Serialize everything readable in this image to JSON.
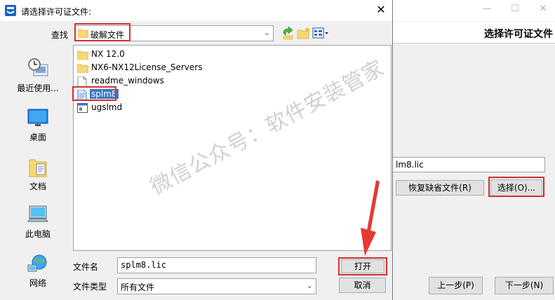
{
  "dialog": {
    "title": "请选择许可证文件:",
    "close_glyph": "✕",
    "look_in_label": "查找",
    "look_in_value": "破解文件",
    "sidebar": [
      {
        "label": "最近使用...",
        "icon": "recent-places-icon"
      },
      {
        "label": "桌面",
        "icon": "desktop-icon"
      },
      {
        "label": "文档",
        "icon": "documents-icon"
      },
      {
        "label": "此电脑",
        "icon": "computer-icon"
      },
      {
        "label": "网络",
        "icon": "network-icon"
      }
    ],
    "files": [
      {
        "name": "NX 12.0",
        "type": "folder"
      },
      {
        "name": "NX6-NX12License_Servers",
        "type": "folder"
      },
      {
        "name": "readme_windows",
        "type": "text-file"
      },
      {
        "name": "splm8",
        "type": "text-file",
        "selected": true
      },
      {
        "name": "ugslmd",
        "type": "application"
      }
    ],
    "file_name_label": "文件名",
    "file_name_value": "splm8.lic",
    "file_type_label": "文件类型",
    "file_type_value": "所有文件",
    "open_label": "打开",
    "cancel_label": "取消"
  },
  "background_window": {
    "header_title": "选择许可证文件",
    "path_value": "lm8.lic",
    "restore_label": "恢复缺省文件(R)",
    "select_label": "选择(O)...",
    "prev_label": "上一步(P)",
    "next_label": "下一步(N)"
  },
  "watermark": "微信公众号：软件安装管家",
  "colors": {
    "highlight": "#d32f2f",
    "selection": "#3a78c9",
    "folder": "#f8d775"
  }
}
